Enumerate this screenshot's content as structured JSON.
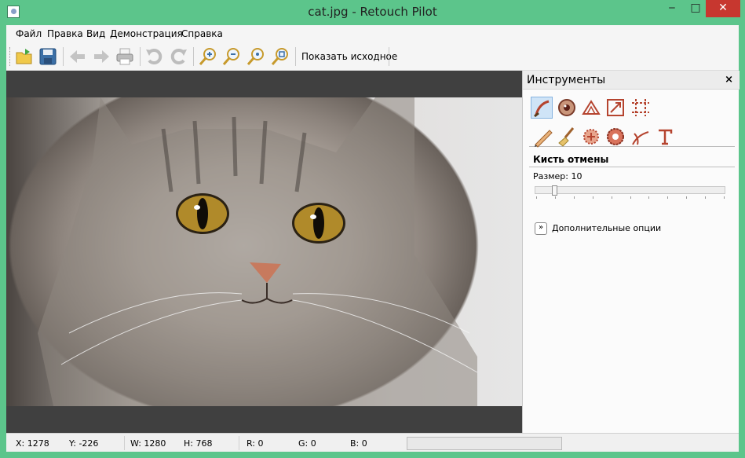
{
  "window": {
    "title": "cat.jpg - Retouch Pilot",
    "min": "‒",
    "max": "□",
    "close": "✕"
  },
  "menu": [
    "Файл",
    "Правка",
    "Вид",
    "Демонстрация",
    "Справка"
  ],
  "toolbar": {
    "show_original": "Показать исходное"
  },
  "panel": {
    "title": "Инструменты",
    "close": "×",
    "tool_section_title": "Кисть отмены",
    "size_label": "Размер:",
    "size_value": 10,
    "more_options": "Дополнительные опции",
    "more_icon": "»"
  },
  "status": {
    "x": "X: 1278",
    "y": "Y: -226",
    "w": "W: 1280",
    "h": "H: 768",
    "r": "R: 0",
    "g": "G: 0",
    "b": "B: 0"
  },
  "colors": {
    "title_bar": "#5cc58b",
    "close_button": "#c7372f",
    "canvas_bg": "#404040"
  }
}
